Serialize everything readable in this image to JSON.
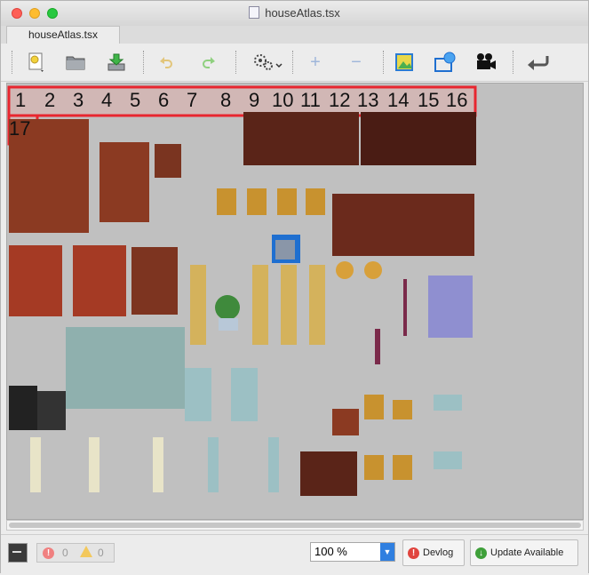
{
  "window": {
    "title": "houseAtlas.tsx"
  },
  "tab": {
    "label": "houseAtlas.tsx"
  },
  "toolbar": {
    "buttons": [
      "new-file",
      "open-folder",
      "save",
      "undo",
      "redo",
      "settings",
      "zoom-in",
      "zoom-out",
      "atlas-image",
      "region-select",
      "video-camera",
      "return"
    ]
  },
  "tileset": {
    "tile_labels": [
      "1",
      "2",
      "3",
      "4",
      "5",
      "6",
      "7",
      "8",
      "9",
      "10",
      "11",
      "12",
      "13",
      "14",
      "15",
      "16",
      "17"
    ],
    "highlight_color": "#e8262f",
    "background": "#c0c0c0"
  },
  "statusbar": {
    "errors": "0",
    "warnings": "0",
    "zoom": "100 %",
    "devlog_label": "Devlog",
    "update_label": "Update Available"
  }
}
